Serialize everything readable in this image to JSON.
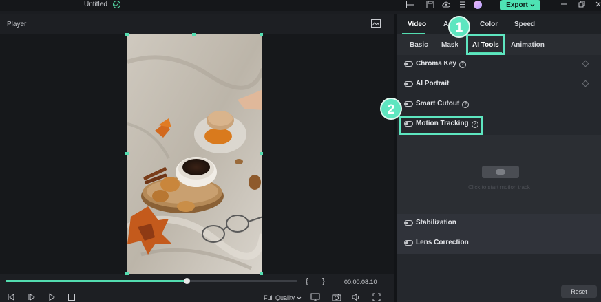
{
  "app": {
    "title": "Untitled",
    "export_label": "Export",
    "accent": "#53ddb0"
  },
  "icons": {
    "saved_status": "check-circle-icon",
    "layout": "layout-icon",
    "save": "save-icon",
    "cloud": "cloud-upload-icon",
    "menu": "menu-icon",
    "minimize": "minimize-icon",
    "restore": "restore-icon",
    "close": "close-icon"
  },
  "player": {
    "header": "Player",
    "progress": 0.62,
    "timecode": "00:00:08:10",
    "mark_in": "{",
    "mark_out": "}",
    "quality": "Full Quality"
  },
  "panel": {
    "tabs_primary": [
      {
        "label": "Video"
      },
      {
        "label": "A"
      },
      {
        "label": "Color"
      },
      {
        "label": "Speed"
      }
    ],
    "tabs_secondary": [
      {
        "label": "Basic"
      },
      {
        "label": "Mask"
      },
      {
        "label": "AI Tools"
      },
      {
        "label": "Animation"
      }
    ],
    "features": [
      {
        "label": "Chroma Key",
        "help": "?"
      },
      {
        "label": "AI Portrait"
      },
      {
        "label": "Smart Cutout",
        "help": "?"
      },
      {
        "label": "Motion Tracking",
        "help": "?"
      },
      {
        "label": "Stabilization"
      },
      {
        "label": "Lens Correction"
      }
    ],
    "tracking_hint": "Click to start motion track",
    "reset_label": "Reset"
  },
  "badges": [
    "1",
    "2"
  ]
}
